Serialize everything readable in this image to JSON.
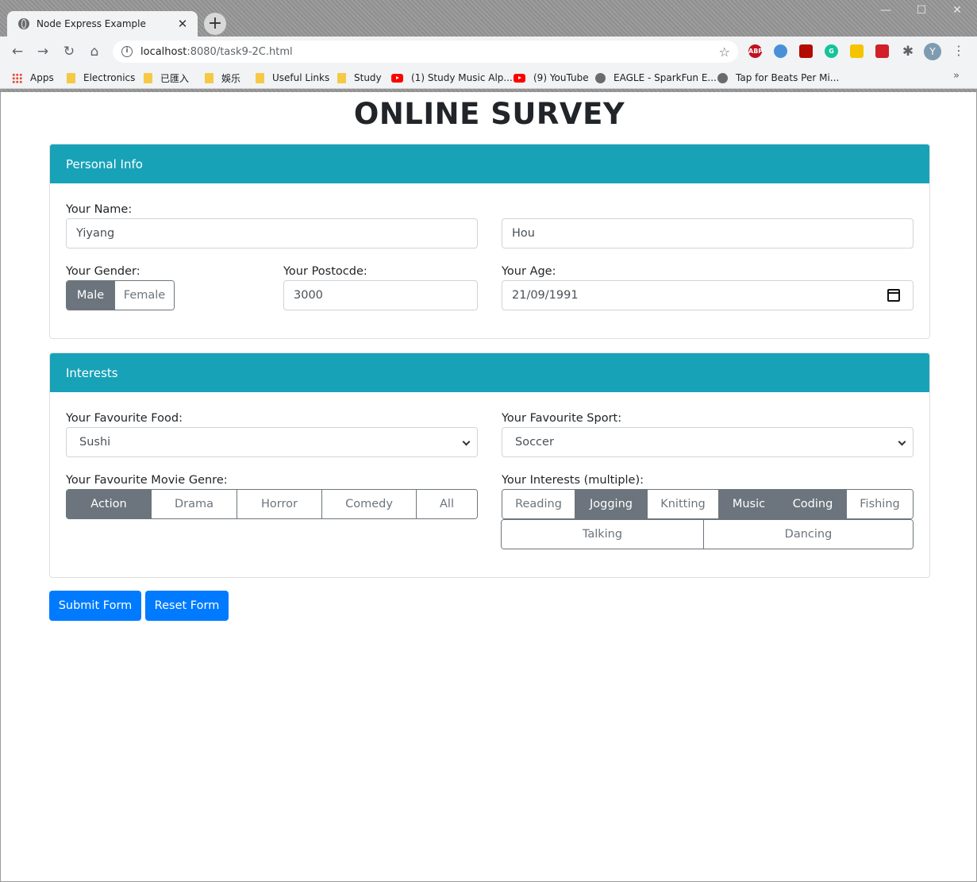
{
  "browser": {
    "tab_title": "Node Express Example",
    "url_host": "localhost",
    "url_rest": ":8080/task9-2C.html",
    "avatar_letter": "Y",
    "bookmarks": [
      {
        "label": "Apps",
        "icon": "apps-grid-icon"
      },
      {
        "label": "Electronics",
        "icon": "folder-icon"
      },
      {
        "label": "已匯入",
        "icon": "folder-icon"
      },
      {
        "label": "娛乐",
        "icon": "folder-icon"
      },
      {
        "label": "Useful Links",
        "icon": "folder-icon"
      },
      {
        "label": "Study",
        "icon": "folder-icon"
      },
      {
        "label": "(1) Study Music Alp...",
        "icon": "youtube-icon"
      },
      {
        "label": "(9) YouTube",
        "icon": "youtube-icon"
      },
      {
        "label": "EAGLE - SparkFun E...",
        "icon": "globe-icon"
      },
      {
        "label": "Tap for Beats Per Mi...",
        "icon": "globe-icon"
      }
    ]
  },
  "page": {
    "title": "ONLINE SURVEY",
    "personal": {
      "header": "Personal Info",
      "name_label": "Your Name:",
      "first_name": "Yiyang",
      "last_name": "Hou",
      "gender_label": "Your Gender:",
      "gender_options": [
        "Male",
        "Female"
      ],
      "gender_selected": "Male",
      "postcode_label": "Your Postocde:",
      "postcode": "3000",
      "age_label": "Your Age:",
      "dob": "21/09/1991"
    },
    "interests": {
      "header": "Interests",
      "food_label": "Your Favourite Food:",
      "food": "Sushi",
      "sport_label": "Your Favourite Sport:",
      "sport": "Soccer",
      "genre_label": "Your Favourite Movie Genre:",
      "genres": [
        "Action",
        "Drama",
        "Horror",
        "Comedy",
        "All"
      ],
      "genre_selected": "Action",
      "interests_label": "Your Interests (multiple):",
      "interest_row1": [
        "Reading",
        "Jogging",
        "Knitting",
        "Music",
        "Coding",
        "Fishing"
      ],
      "interest_row2": [
        "Talking",
        "Dancing"
      ],
      "interests_selected": [
        "Jogging",
        "Music",
        "Coding"
      ]
    },
    "submit_label": "Submit Form",
    "reset_label": "Reset Form"
  }
}
